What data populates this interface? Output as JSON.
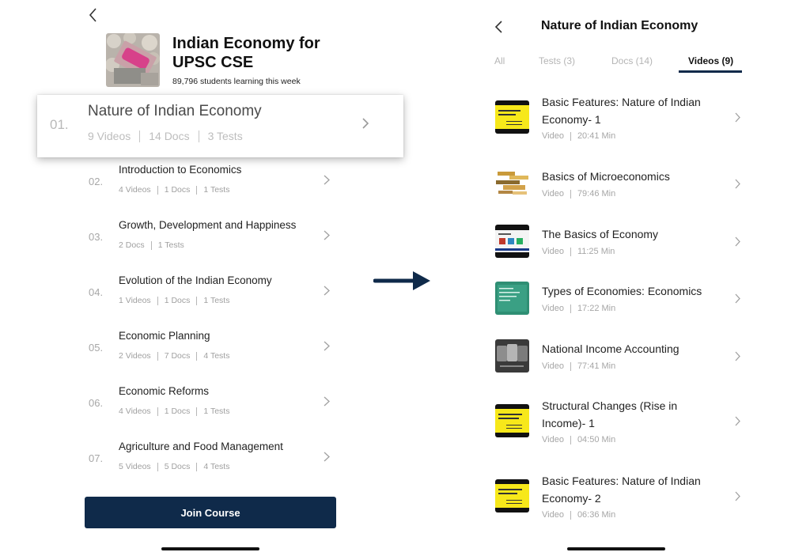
{
  "left": {
    "course": {
      "title": "Indian Economy for UPSC CSE",
      "subtitle": "89,796 students learning this week"
    },
    "highlighted_chapter": {
      "num": "01.",
      "title": "Nature of Indian Economy",
      "meta": [
        "9 Videos",
        "14 Docs",
        "3 Tests"
      ]
    },
    "chapters": [
      {
        "num": "02.",
        "title": "Introduction to Economics",
        "meta": [
          "4 Videos",
          "1 Docs",
          "1 Tests"
        ]
      },
      {
        "num": "03.",
        "title": "Growth, Development and Happiness",
        "meta": [
          "2 Docs",
          "1 Tests"
        ]
      },
      {
        "num": "04.",
        "title": "Evolution of the Indian Economy",
        "meta": [
          "1 Videos",
          "1 Docs",
          "1 Tests"
        ]
      },
      {
        "num": "05.",
        "title": "Economic Planning",
        "meta": [
          "2 Videos",
          "7 Docs",
          "4 Tests"
        ]
      },
      {
        "num": "06.",
        "title": "Economic Reforms",
        "meta": [
          "4 Videos",
          "1 Docs",
          "1 Tests"
        ]
      },
      {
        "num": "07.",
        "title": "Agriculture and Food Management",
        "meta": [
          "5 Videos",
          "5 Docs",
          "4 Tests"
        ]
      }
    ],
    "join_button": "Join Course"
  },
  "right": {
    "title": "Nature of Indian Economy",
    "tabs": [
      {
        "label": "All",
        "active": false
      },
      {
        "label": "Tests (3)",
        "active": false
      },
      {
        "label": "Docs (14)",
        "active": false
      },
      {
        "label": "Videos (9)",
        "active": true
      }
    ],
    "videos": [
      {
        "title": "Basic Features: Nature of Indian Economy- 1",
        "type": "Video",
        "duration": "20:41 Min",
        "thumb": "yellow-slide"
      },
      {
        "title": "Basics of Microeconomics",
        "type": "Video",
        "duration": "79:46 Min",
        "thumb": "word-cloud"
      },
      {
        "title": "The Basics of Economy",
        "type": "Video",
        "duration": "11:25 Min",
        "thumb": "slide-deck"
      },
      {
        "title": "Types of Economies: Economics",
        "type": "Video",
        "duration": "17:22 Min",
        "thumb": "chalkboard"
      },
      {
        "title": "National Income Accounting",
        "type": "Video",
        "duration": "77:41 Min",
        "thumb": "gdp-letters"
      },
      {
        "title": "Structural Changes (Rise in Income)- 1",
        "type": "Video",
        "duration": "04:50 Min",
        "thumb": "yellow-slide"
      },
      {
        "title": "Basic Features: Nature of Indian Economy- 2",
        "type": "Video",
        "duration": "06:36 Min",
        "thumb": "yellow-slide"
      }
    ]
  },
  "colors": {
    "primary_navy": "#0f2a4a",
    "muted_text": "#a6a6a6",
    "thumbnail_yellow": "#f7e81a"
  },
  "icons": [
    "back-icon",
    "chevron-right-icon",
    "arrow-right-icon"
  ]
}
